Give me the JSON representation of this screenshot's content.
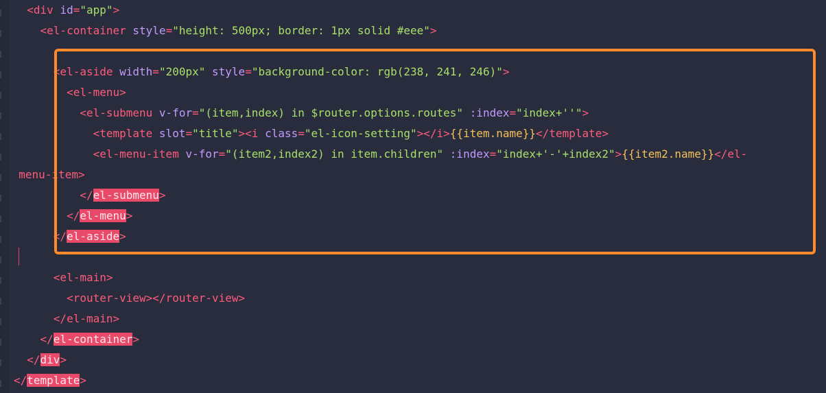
{
  "editor": {
    "lines": [
      {
        "indent": "  ",
        "parts": [
          [
            "tag",
            "<div "
          ],
          [
            "attr",
            "id"
          ],
          [
            "punct",
            "="
          ],
          [
            "str",
            "\"app\""
          ],
          [
            "tag",
            ">"
          ]
        ]
      },
      {
        "indent": "    ",
        "parts": [
          [
            "tag",
            "<el-container "
          ],
          [
            "attr",
            "style"
          ],
          [
            "punct",
            "="
          ],
          [
            "str",
            "\"height: 500px; border: 1px solid #eee\""
          ],
          [
            "tag",
            ">"
          ]
        ]
      },
      {
        "indent": "",
        "parts": []
      },
      {
        "indent": "      ",
        "parts": [
          [
            "tag",
            "<el-aside "
          ],
          [
            "attr",
            "width"
          ],
          [
            "punct",
            "="
          ],
          [
            "str",
            "\"200px\""
          ],
          [
            "text",
            " "
          ],
          [
            "attr",
            "style"
          ],
          [
            "punct",
            "="
          ],
          [
            "str",
            "\"background-color: rgb(238, 241, 246)\""
          ],
          [
            "tag",
            ">"
          ]
        ]
      },
      {
        "indent": "        ",
        "parts": [
          [
            "tag",
            "<el-menu>"
          ]
        ]
      },
      {
        "indent": "          ",
        "parts": [
          [
            "tag",
            "<el-submenu "
          ],
          [
            "attr",
            "v-for"
          ],
          [
            "punct",
            "="
          ],
          [
            "str",
            "\"(item,index) in $router.options.routes\""
          ],
          [
            "text",
            " "
          ],
          [
            "attr",
            ":index"
          ],
          [
            "punct",
            "="
          ],
          [
            "str",
            "\"index+''\""
          ],
          [
            "tag",
            ">"
          ]
        ]
      },
      {
        "indent": "            ",
        "parts": [
          [
            "tag",
            "<template "
          ],
          [
            "attr",
            "slot"
          ],
          [
            "punct",
            "="
          ],
          [
            "str",
            "\"title\""
          ],
          [
            "tag",
            "><i "
          ],
          [
            "attr",
            "class"
          ],
          [
            "punct",
            "="
          ],
          [
            "str",
            "\"el-icon-setting\""
          ],
          [
            "tag",
            "></i>"
          ],
          [
            "mustache",
            "{{item.name}}"
          ],
          [
            "tag",
            "</template>"
          ]
        ]
      },
      {
        "indent": "            ",
        "parts": [
          [
            "tag",
            "<el-menu-item "
          ],
          [
            "attr",
            "v-for"
          ],
          [
            "punct",
            "="
          ],
          [
            "str",
            "\"(item2,index2) in item.children\""
          ],
          [
            "text",
            " "
          ],
          [
            "attr",
            ":index"
          ],
          [
            "punct",
            "="
          ],
          [
            "str",
            "\"index+'-'+index2\""
          ],
          [
            "tag",
            ">"
          ],
          [
            "mustache",
            "{{item2.name}}"
          ],
          [
            "tag",
            "</el-"
          ]
        ]
      },
      {
        "indent": "  ",
        "parts": [
          [
            "tag",
            "menu-item>"
          ]
        ]
      },
      {
        "indent": "          ",
        "parts": [
          [
            "hl-wrap",
            "</"
          ],
          [
            "hl",
            "el-submenu"
          ],
          [
            "hl-wrap",
            ">"
          ]
        ]
      },
      {
        "indent": "        ",
        "parts": [
          [
            "hl-wrap",
            "</"
          ],
          [
            "hl",
            "el-menu"
          ],
          [
            "hl-wrap",
            ">"
          ]
        ]
      },
      {
        "indent": "      ",
        "parts": [
          [
            "hl-wrap",
            "</"
          ],
          [
            "hl",
            "el-aside"
          ],
          [
            "hl-wrap",
            ">"
          ]
        ]
      },
      {
        "indent": "",
        "parts": []
      },
      {
        "indent": "      ",
        "parts": [
          [
            "tag",
            "<el-main>"
          ]
        ]
      },
      {
        "indent": "        ",
        "parts": [
          [
            "tag",
            "<router-view></router-view>"
          ]
        ]
      },
      {
        "indent": "      ",
        "parts": [
          [
            "tag",
            "</el-main>"
          ]
        ]
      },
      {
        "indent": "    ",
        "parts": [
          [
            "hl-wrap",
            "</"
          ],
          [
            "hl",
            "el-container"
          ],
          [
            "hl-wrap",
            ">"
          ]
        ]
      },
      {
        "indent": "  ",
        "parts": [
          [
            "hl-wrap",
            "</"
          ],
          [
            "hl",
            "div"
          ],
          [
            "hl-wrap",
            ">"
          ]
        ]
      },
      {
        "indent": "",
        "parts": [
          [
            "hl-wrap",
            "</"
          ],
          [
            "hl",
            "template"
          ],
          [
            "hl-wrap",
            ">"
          ]
        ]
      }
    ]
  }
}
